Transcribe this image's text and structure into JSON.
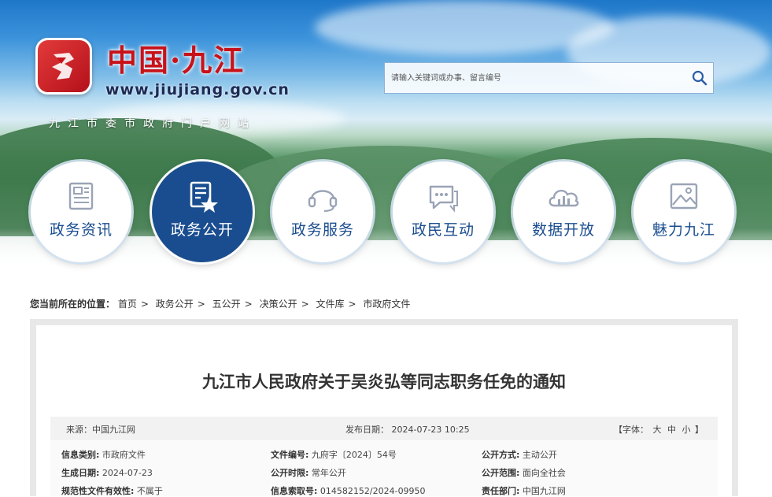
{
  "header": {
    "site_name": "中国·九江",
    "site_url": "www.jiujiang.gov.cn",
    "site_subtitle": "九江市委市政府门户网站",
    "logo_icon": "jiujiang-logo-icon",
    "colors": {
      "brand_red": "#c8121a",
      "nav_blue": "#1a4d8f"
    }
  },
  "search": {
    "placeholder": "请输入关键词或办事、留言编号",
    "icon": "search-icon"
  },
  "nav": {
    "items": [
      {
        "label": "政务资讯",
        "icon": "newspaper-icon",
        "active": false
      },
      {
        "label": "政务公开",
        "icon": "document-star-icon",
        "active": true
      },
      {
        "label": "政务服务",
        "icon": "headset-icon",
        "active": false
      },
      {
        "label": "政民互动",
        "icon": "chat-bubble-icon",
        "active": false
      },
      {
        "label": "数据开放",
        "icon": "cloud-chart-icon",
        "active": false
      },
      {
        "label": "魅力九江",
        "icon": "picture-icon",
        "active": false
      }
    ]
  },
  "breadcrumb": {
    "prefix": "您当前所在的位置：",
    "items": [
      "首页",
      "政务公开",
      "五公开",
      "决策公开",
      "文件库",
      "市政府文件"
    ],
    "separator": ">"
  },
  "article": {
    "title": "九江市人民政府关于吴炎弘等同志职务任免的通知",
    "source": "来源：中国九江网",
    "publish_date": "发布日期： 2024-07-23 10:25",
    "font_size": {
      "open": "【字体：",
      "large": "大",
      "medium": "中",
      "small": "小",
      "close": "】"
    },
    "info": {
      "category_key": "信息类别:",
      "category_val": "市政府文件",
      "doc_no_key": "文件编号:",
      "doc_no_val": "九府字〔2024〕54号",
      "method_key": "公开方式:",
      "method_val": "主动公开",
      "gen_date_key": "生成日期:",
      "gen_date_val": "2024-07-23",
      "period_key": "公开时限:",
      "period_val": "常年公开",
      "scope_key": "公开范围:",
      "scope_val": "面向全社会",
      "validity_key": "规范性文件有效性:",
      "validity_val": "不属于",
      "index_key": "信息索取号:",
      "index_val": "014582152/2024-09950",
      "dept_key": "责任部门:",
      "dept_val": "中国九江网"
    }
  }
}
